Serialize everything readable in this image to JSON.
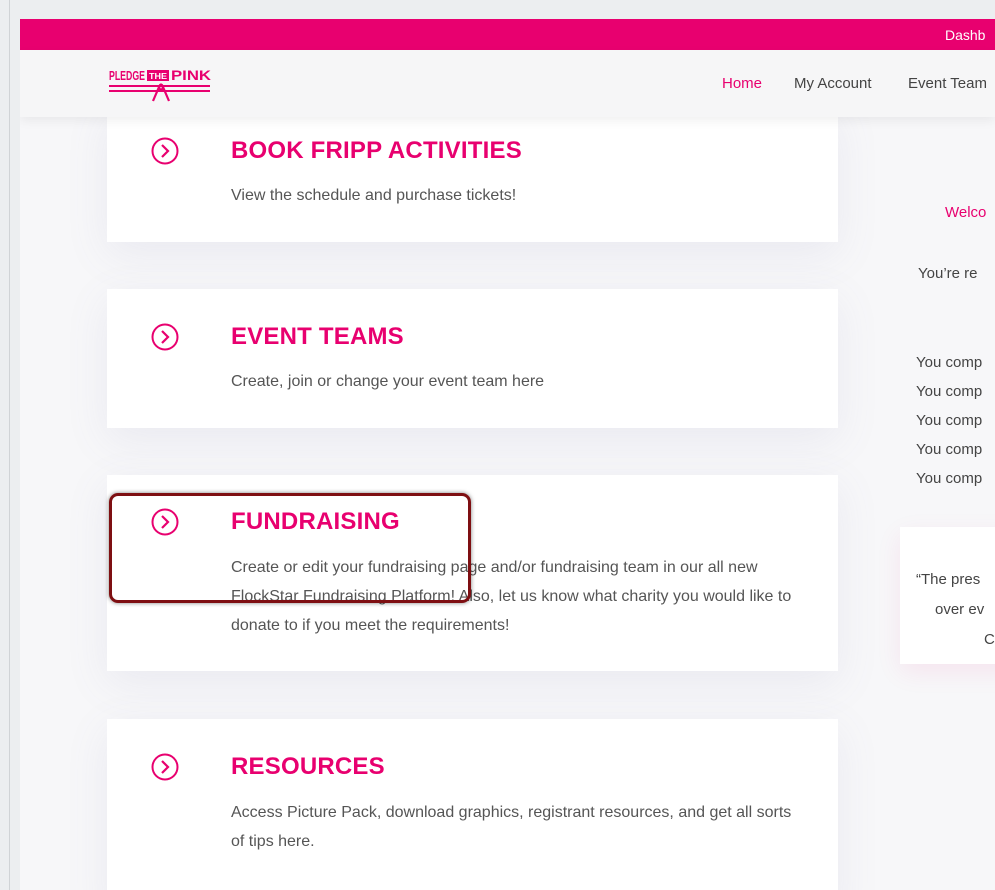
{
  "topbar": {
    "link": "Dashb"
  },
  "header": {
    "logo": {
      "text_left": "PLEDGE",
      "text_mid": "THE",
      "text_right": "PINK"
    },
    "nav": [
      {
        "label": "Home",
        "active": true
      },
      {
        "label": "My Account",
        "active": false
      },
      {
        "label": "Event Team",
        "active": false
      }
    ]
  },
  "cards": [
    {
      "title": "BOOK FRIPP ACTIVITIES",
      "description": "View the schedule and purchase tickets!",
      "icon": "circle-chevron-right-icon"
    },
    {
      "title": "EVENT TEAMS",
      "description": "Create, join or change your event team here",
      "icon": "circle-chevron-right-icon"
    },
    {
      "title": "FUNDRAISING",
      "description": "Create or edit your fundraising page and/or fundraising team in our all new FlockStar Fundraising Platform! Also, let us know what charity you would like to donate to if you meet the requirements!",
      "icon": "circle-chevron-right-icon"
    },
    {
      "title": "RESOURCES",
      "description": "Access Picture Pack, download graphics, registrant resources, and get all sorts of tips here.",
      "icon": "circle-chevron-right-icon"
    }
  ],
  "right_column": {
    "welcome": "Welco",
    "registered": "You’re re",
    "completed_lines": [
      "You comp",
      "You comp",
      "You comp",
      "You comp",
      "You comp"
    ],
    "quote_lines": [
      "“The pres",
      "over ev",
      "C"
    ]
  },
  "colors": {
    "brand": "#e8006f",
    "highlight": "#7e0f12"
  }
}
